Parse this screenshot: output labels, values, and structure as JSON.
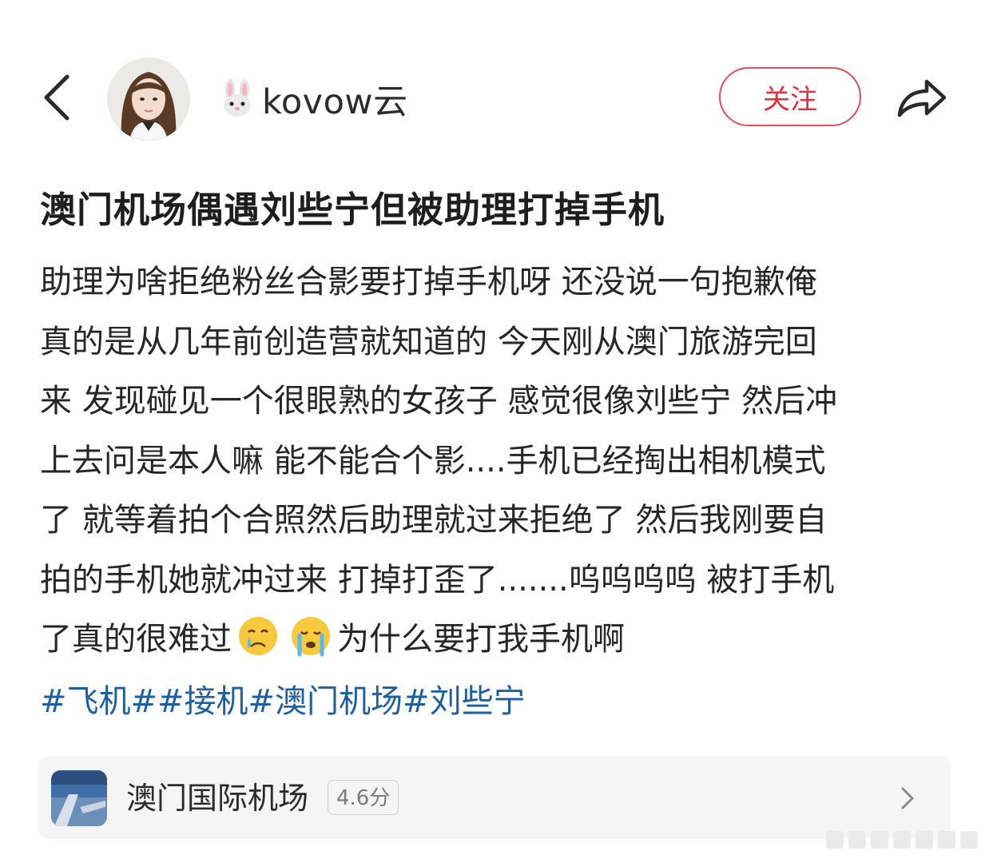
{
  "header": {
    "username": "kovow云",
    "follow_label": "关注"
  },
  "post": {
    "title": "澳门机场偶遇刘些宁但被助理打掉手机",
    "lines": [
      "助理为啥拒绝粉丝合影要打掉手机呀 还没说一句抱歉俺",
      "真的是从几年前创造营就知道的 今天刚从澳门旅游完回",
      "来 发现碰见一个很眼熟的女孩子 感觉很像刘些宁 然后冲",
      "上去问是本人嘛 能不能合个影....手机已经掏出相机模式",
      "了 就等着拍个合照然后助理就过来拒绝了 然后我刚要自",
      "拍的手机她就冲过来 打掉打歪了.......呜呜呜呜 被打手机"
    ],
    "last_line_before": "了真的很难过",
    "last_line_after": "为什么要打我手机啊",
    "tags": [
      "#飞机#",
      "#接机#",
      "澳门机场#",
      "刘些宁"
    ]
  },
  "location": {
    "name": "澳门国际机场",
    "score": "4.6分"
  },
  "icons": {
    "back": "chevron-left-icon",
    "share": "share-arrow-icon",
    "rabbit": "rabbit-face-emoji",
    "cry": "crying-face-emoji",
    "chevron": "chevron-right-icon"
  },
  "colors": {
    "follow": "#e0303f",
    "tag": "#1d5fa0",
    "card_bg": "#f5f5f5"
  }
}
